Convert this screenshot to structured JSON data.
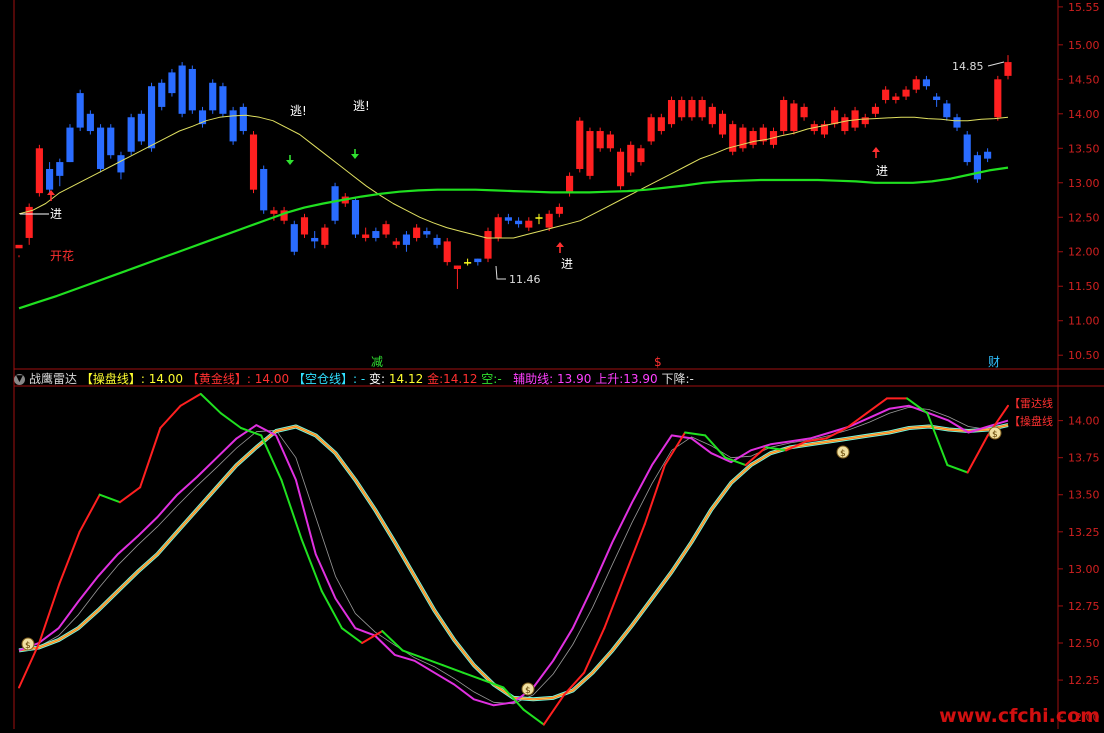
{
  "colors": {
    "frame": "#a01010",
    "up": "#ff2020",
    "down": "#2a6cff",
    "doji": "#ffff20",
    "ma_short": "#e0e060",
    "ma_long": "#20e020",
    "axis_text": "#d02020"
  },
  "signals": {
    "jin": "进",
    "tao": "逃!",
    "kaihua": "开花",
    "high_label": "14.85",
    "low_label": "11.46",
    "markers": [
      "减",
      "$",
      "财"
    ]
  },
  "indicator_header": {
    "collapse_icon": "chevron-down-icon",
    "name": "战鹰雷达",
    "caopan_label": "【操盘线】",
    "caopan_value": ": 14.00",
    "huangjin_label": "【黄金线】",
    "huangjin_value": ": 14.00",
    "kongcang_label": "【空仓线】",
    "kongcang_value": ": -",
    "bian_label": "变:",
    "bian_value": "14.12",
    "jin_label": "金:",
    "jin_value": "14.12",
    "kong_label": "空:",
    "kong_value": "-",
    "fuzhu_label": "辅助线:",
    "fuzhu_value": "13.90",
    "shangsheng_label": "上升:",
    "shangsheng_value": "13.90",
    "xiajiang_label": "下降:",
    "xiajiang_value": "-"
  },
  "right_legend": {
    "leida": "【雷达线",
    "caopan": "【操盘线"
  },
  "watermark": "www.cfchi.com",
  "chart_data": [
    {
      "type": "candlestick",
      "y_ticks": [
        "15.55",
        "15.00",
        "14.50",
        "14.00",
        "13.50",
        "13.00",
        "12.50",
        "12.00",
        "11.50",
        "11.00",
        "10.50"
      ],
      "ylim": [
        10.3,
        15.65
      ],
      "candles": [
        [
          12.05,
          12.1,
          11.95,
          11.92
        ],
        [
          12.2,
          12.65,
          12.7,
          12.1
        ],
        [
          12.85,
          13.5,
          13.55,
          12.8
        ],
        [
          13.2,
          12.9,
          13.3,
          12.85
        ],
        [
          13.3,
          13.1,
          13.35,
          12.95
        ],
        [
          13.8,
          13.3,
          13.85,
          13.3
        ],
        [
          14.3,
          13.8,
          14.35,
          13.75
        ],
        [
          14.0,
          13.75,
          14.05,
          13.7
        ],
        [
          13.8,
          13.2,
          13.85,
          13.15
        ],
        [
          13.8,
          13.4,
          13.85,
          13.35
        ],
        [
          13.4,
          13.15,
          13.45,
          13.05
        ],
        [
          13.95,
          13.45,
          14.0,
          13.4
        ],
        [
          14.0,
          13.6,
          14.05,
          13.55
        ],
        [
          14.4,
          13.5,
          14.45,
          13.45
        ],
        [
          14.45,
          14.1,
          14.5,
          14.05
        ],
        [
          14.6,
          14.3,
          14.65,
          14.25
        ],
        [
          14.7,
          14.0,
          14.75,
          13.95
        ],
        [
          14.65,
          14.05,
          14.7,
          14.0
        ],
        [
          14.05,
          13.85,
          14.1,
          13.8
        ],
        [
          14.45,
          14.05,
          14.5,
          14.0
        ],
        [
          14.4,
          14.0,
          14.45,
          13.95
        ],
        [
          14.05,
          13.6,
          14.1,
          13.55
        ],
        [
          14.1,
          13.75,
          14.15,
          13.7
        ],
        [
          12.9,
          13.7,
          13.75,
          12.85
        ],
        [
          13.2,
          12.6,
          13.25,
          12.55
        ],
        [
          12.55,
          12.6,
          12.65,
          12.45
        ],
        [
          12.45,
          12.6,
          12.65,
          12.4
        ],
        [
          12.4,
          12.0,
          12.45,
          11.95
        ],
        [
          12.25,
          12.5,
          12.55,
          12.2
        ],
        [
          12.2,
          12.15,
          12.3,
          12.05
        ],
        [
          12.1,
          12.35,
          12.4,
          12.05
        ],
        [
          12.95,
          12.45,
          13.0,
          12.4
        ],
        [
          12.7,
          12.8,
          12.85,
          12.65
        ],
        [
          12.75,
          12.25,
          12.8,
          12.2
        ],
        [
          12.2,
          12.25,
          12.35,
          12.15
        ],
        [
          12.3,
          12.2,
          12.35,
          12.15
        ],
        [
          12.25,
          12.4,
          12.45,
          12.2
        ],
        [
          12.1,
          12.15,
          12.2,
          12.05
        ],
        [
          12.25,
          12.1,
          12.3,
          12.0
        ],
        [
          12.2,
          12.35,
          12.4,
          12.15
        ],
        [
          12.3,
          12.25,
          12.35,
          12.2
        ],
        [
          12.2,
          12.1,
          12.25,
          12.05
        ],
        [
          11.85,
          12.15,
          12.2,
          11.8
        ],
        [
          11.75,
          11.8,
          11.8,
          11.46
        ],
        [
          11.85,
          11.85,
          11.9,
          11.8
        ],
        [
          11.9,
          11.85,
          11.9,
          11.8
        ],
        [
          11.9,
          12.3,
          12.35,
          11.85
        ],
        [
          12.2,
          12.5,
          12.55,
          12.15
        ],
        [
          12.5,
          12.45,
          12.55,
          12.4
        ],
        [
          12.45,
          12.4,
          12.5,
          12.35
        ],
        [
          12.35,
          12.45,
          12.5,
          12.3
        ],
        [
          12.5,
          12.5,
          12.55,
          12.4
        ],
        [
          12.35,
          12.55,
          12.6,
          12.3
        ],
        [
          12.55,
          12.65,
          12.7,
          12.5
        ],
        [
          12.85,
          13.1,
          13.15,
          12.8
        ],
        [
          13.2,
          13.9,
          13.95,
          13.15
        ],
        [
          13.1,
          13.75,
          13.8,
          13.05
        ],
        [
          13.5,
          13.75,
          13.8,
          13.45
        ],
        [
          13.5,
          13.7,
          13.75,
          13.45
        ],
        [
          12.95,
          13.45,
          13.5,
          12.9
        ],
        [
          13.15,
          13.55,
          13.6,
          13.1
        ],
        [
          13.3,
          13.5,
          13.55,
          13.25
        ],
        [
          13.6,
          13.95,
          14.0,
          13.55
        ],
        [
          13.75,
          13.95,
          14.0,
          13.7
        ],
        [
          13.85,
          14.2,
          14.25,
          13.8
        ],
        [
          13.95,
          14.2,
          14.25,
          13.9
        ],
        [
          13.95,
          14.2,
          14.25,
          13.9
        ],
        [
          13.95,
          14.2,
          14.25,
          13.9
        ],
        [
          13.85,
          14.1,
          14.15,
          13.8
        ],
        [
          13.7,
          14.0,
          14.05,
          13.65
        ],
        [
          13.45,
          13.85,
          13.9,
          13.4
        ],
        [
          13.5,
          13.8,
          13.85,
          13.45
        ],
        [
          13.55,
          13.75,
          13.8,
          13.5
        ],
        [
          13.6,
          13.8,
          13.85,
          13.55
        ],
        [
          13.55,
          13.75,
          13.8,
          13.5
        ],
        [
          13.75,
          14.2,
          14.25,
          13.7
        ],
        [
          13.75,
          14.15,
          14.2,
          13.7
        ],
        [
          13.95,
          14.1,
          14.15,
          13.9
        ],
        [
          13.75,
          13.85,
          13.9,
          13.7
        ],
        [
          13.7,
          13.85,
          13.9,
          13.65
        ],
        [
          13.85,
          14.05,
          14.1,
          13.8
        ],
        [
          13.75,
          13.95,
          14.0,
          13.7
        ],
        [
          13.8,
          14.05,
          14.1,
          13.75
        ],
        [
          13.85,
          13.95,
          14.0,
          13.8
        ],
        [
          14.0,
          14.1,
          14.15,
          13.95
        ],
        [
          14.2,
          14.35,
          14.4,
          14.15
        ],
        [
          14.2,
          14.25,
          14.3,
          14.15
        ],
        [
          14.25,
          14.35,
          14.4,
          14.2
        ],
        [
          14.35,
          14.5,
          14.55,
          14.3
        ],
        [
          14.5,
          14.4,
          14.55,
          14.35
        ],
        [
          14.25,
          14.2,
          14.3,
          14.1
        ],
        [
          14.15,
          13.95,
          14.2,
          13.9
        ],
        [
          13.95,
          13.8,
          14.0,
          13.75
        ],
        [
          13.7,
          13.3,
          13.75,
          13.25
        ],
        [
          13.4,
          13.05,
          13.45,
          13.0
        ],
        [
          13.45,
          13.35,
          13.5,
          13.3
        ],
        [
          13.95,
          14.5,
          14.55,
          13.9
        ],
        [
          14.55,
          14.75,
          14.85,
          14.5
        ]
      ],
      "ma_short": [
        12.55,
        12.6,
        12.7,
        12.85,
        12.95,
        13.05,
        13.15,
        13.25,
        13.35,
        13.45,
        13.55,
        13.65,
        13.75,
        13.82,
        13.9,
        13.95,
        13.97,
        13.98,
        13.95,
        13.9,
        13.8,
        13.7,
        13.55,
        13.4,
        13.25,
        13.1,
        12.95,
        12.82,
        12.7,
        12.6,
        12.5,
        12.42,
        12.35,
        12.3,
        12.25,
        12.2,
        12.2,
        12.2,
        12.25,
        12.3,
        12.35,
        12.4,
        12.45,
        12.55,
        12.65,
        12.75,
        12.85,
        12.95,
        13.05,
        13.15,
        13.25,
        13.35,
        13.42,
        13.5,
        13.55,
        13.6,
        13.63,
        13.68,
        13.72,
        13.78,
        13.82,
        13.86,
        13.9,
        13.92,
        13.93,
        13.94,
        13.95,
        13.95,
        13.93,
        13.92,
        13.9,
        13.9,
        13.92,
        13.93,
        13.95
      ],
      "ma_long": [
        11.18,
        11.27,
        11.36,
        11.46,
        11.56,
        11.66,
        11.76,
        11.86,
        11.96,
        12.06,
        12.16,
        12.26,
        12.36,
        12.46,
        12.56,
        12.64,
        12.7,
        12.75,
        12.8,
        12.84,
        12.87,
        12.89,
        12.9,
        12.9,
        12.9,
        12.89,
        12.88,
        12.87,
        12.86,
        12.86,
        12.86,
        12.87,
        12.88,
        12.9,
        12.93,
        12.96,
        13.0,
        13.02,
        13.03,
        13.04,
        13.04,
        13.04,
        13.04,
        13.03,
        13.02,
        13.0,
        13.0,
        13.0,
        13.02,
        13.06,
        13.12,
        13.18,
        13.22
      ]
    },
    {
      "type": "line",
      "y_ticks": [
        "14.00",
        "13.75",
        "13.50",
        "13.25",
        "13.00",
        "12.75",
        "12.50",
        "12.25",
        "12.00"
      ],
      "ylim": [
        11.92,
        14.22
      ],
      "series": [
        {
          "values": [
            12.45,
            12.47,
            12.52,
            12.6,
            12.72,
            12.85,
            12.98,
            13.1,
            13.25,
            13.4,
            13.55,
            13.7,
            13.82,
            13.93,
            13.96,
            13.9,
            13.78,
            13.6,
            13.4,
            13.18,
            12.95,
            12.72,
            12.52,
            12.35,
            12.22,
            12.13,
            12.12,
            12.13,
            12.18,
            12.3,
            12.45,
            12.62,
            12.8,
            12.98,
            13.18,
            13.4,
            13.58,
            13.7,
            13.78,
            13.82,
            13.84,
            13.86,
            13.88,
            13.9,
            13.92,
            13.95,
            13.96,
            13.94,
            13.93,
            13.94,
            13.97
          ]
        },
        {
          "values": [
            12.45,
            12.5,
            12.6,
            12.78,
            12.95,
            13.1,
            13.22,
            13.35,
            13.5,
            13.62,
            13.75,
            13.88,
            13.97,
            13.9,
            13.6,
            13.1,
            12.8,
            12.6,
            12.55,
            12.42,
            12.38,
            12.3,
            12.22,
            12.12,
            12.08,
            12.1,
            12.2,
            12.38,
            12.6,
            12.88,
            13.18,
            13.45,
            13.7,
            13.9,
            13.88,
            13.78,
            13.72,
            13.8,
            13.84,
            13.86,
            13.88,
            13.92,
            13.96,
            14.02,
            14.08,
            14.1,
            14.05,
            14.0,
            13.92,
            13.96,
            14.0
          ]
        },
        {
          "values": [
            12.2,
            12.5,
            12.9,
            13.25,
            13.5,
            13.45,
            13.55,
            13.95,
            14.1,
            14.18,
            14.05,
            13.95,
            13.9,
            13.6,
            13.2,
            12.85,
            12.6,
            12.5,
            12.58,
            12.45,
            12.4,
            12.35,
            12.3,
            12.25,
            12.2,
            12.05,
            11.95,
            12.15,
            12.3,
            12.6,
            12.95,
            13.3,
            13.7,
            13.92,
            13.9,
            13.75,
            13.7,
            13.82,
            13.8,
            13.86,
            13.88,
            13.95,
            14.05,
            14.15,
            14.15,
            14.05,
            13.7,
            13.65,
            13.9,
            14.1
          ]
        }
      ]
    }
  ]
}
